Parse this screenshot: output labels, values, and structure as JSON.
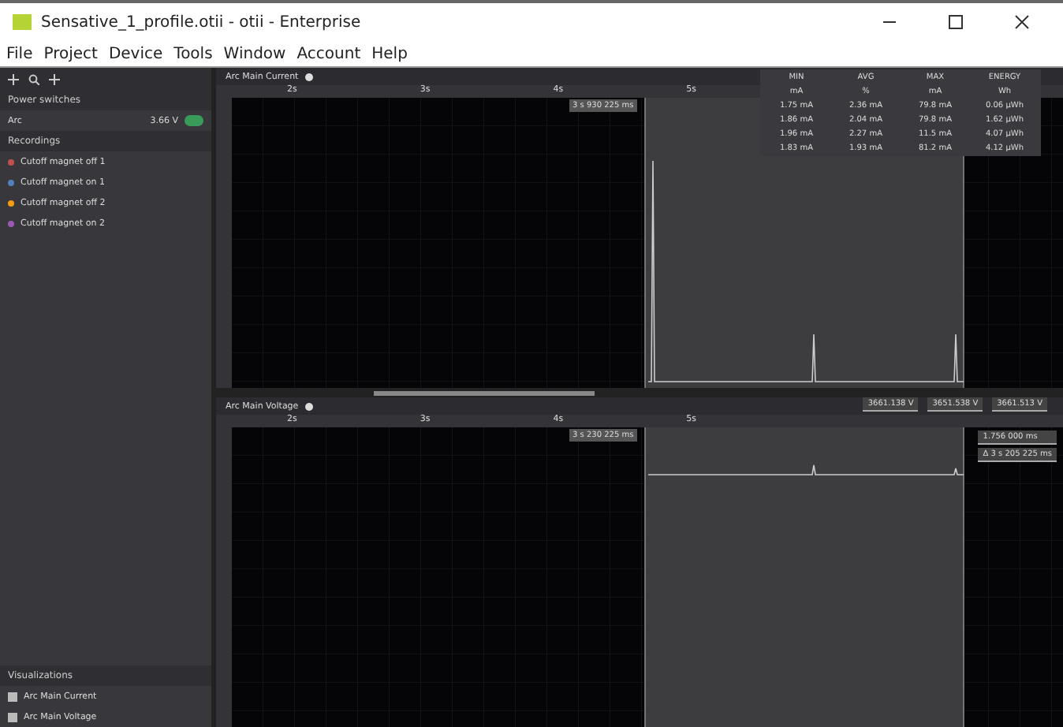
{
  "window": {
    "title": "Sensative_1_profile.otii - otii - Enterprise"
  },
  "menu": [
    "File",
    "Project",
    "Device",
    "Tools",
    "Window",
    "Account",
    "Help"
  ],
  "sidebar": {
    "power_title": "Power switches",
    "device": {
      "name": "Arc",
      "reading": "3.66 V",
      "on": true
    },
    "recordings_title": "Recordings",
    "recordings": [
      {
        "name": "Cutoff magnet off 1",
        "color": "#c0504d"
      },
      {
        "name": "Cutoff magnet on 1",
        "color": "#4f81bd"
      },
      {
        "name": "Cutoff magnet off 2",
        "color": "#f39c12"
      },
      {
        "name": "Cutoff magnet on 2",
        "color": "#9b59b6"
      }
    ],
    "visualizations_title": "Visualizations",
    "visualizations": [
      {
        "name": "Arc Main Current",
        "checked": true
      },
      {
        "name": "Arc Main Voltage",
        "checked": true
      }
    ]
  },
  "plots": [
    {
      "title": "Arc Main Current",
      "ticks": [
        "2s",
        "3s",
        "4s",
        "5s"
      ],
      "cursor": "3 s 930 225 ms",
      "stats": {
        "columns": [
          {
            "name": "MIN",
            "unit": "mA"
          },
          {
            "name": "AVG",
            "unit": "%"
          },
          {
            "name": "MAX",
            "unit": "mA"
          },
          {
            "name": "ENERGY",
            "unit": "Wh"
          }
        ],
        "rows": [
          [
            "1.75 mA",
            "2.36 mA",
            "79.8 mA",
            "0.06 µWh"
          ],
          [
            "1.86 mA",
            "2.04 mA",
            "79.8 mA",
            "1.62 µWh"
          ],
          [
            "1.96 mA",
            "2.27 mA",
            "11.5 mA",
            "4.07 µWh"
          ],
          [
            "1.83 mA",
            "1.93 mA",
            "81.2 mA",
            "4.12 µWh"
          ]
        ]
      }
    },
    {
      "title": "Arc Main Voltage",
      "ticks": [
        "2s",
        "3s",
        "4s",
        "5s"
      ],
      "cursor": "3 s 230 225 ms",
      "markers": [
        "3661.138 V",
        "3651.538 V",
        "3661.513 V"
      ],
      "side": [
        "1.756 000 ms",
        "Δ 3 s 205 225 ms"
      ]
    }
  ]
}
